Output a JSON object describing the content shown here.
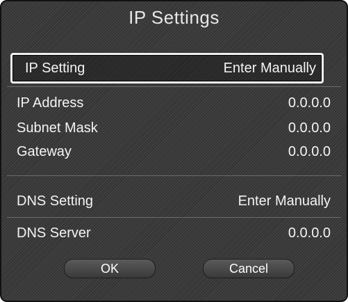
{
  "dialog": {
    "title": "IP Settings"
  },
  "ip_setting": {
    "label": "IP Setting",
    "value": "Enter Manually"
  },
  "ip_fields": [
    {
      "label": "IP Address",
      "value": "0.0.0.0"
    },
    {
      "label": "Subnet Mask",
      "value": "0.0.0.0"
    },
    {
      "label": "Gateway",
      "value": "0.0.0.0"
    }
  ],
  "dns_setting": {
    "label": "DNS Setting",
    "value": "Enter Manually"
  },
  "dns_server": {
    "label": "DNS Server",
    "value": "0.0.0.0"
  },
  "buttons": {
    "ok_label": "OK",
    "cancel_label": "Cancel"
  }
}
